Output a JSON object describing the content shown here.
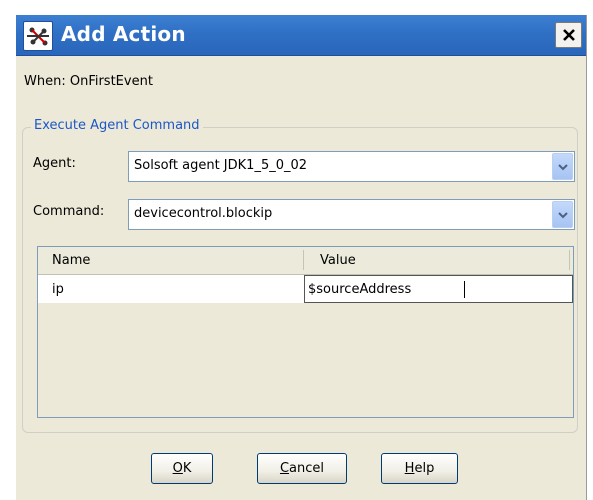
{
  "window": {
    "title": "Add Action",
    "icon": "action-icon",
    "close_label": "×"
  },
  "event_label": "When: OnFirstEvent",
  "group": {
    "label": "Execute Agent Command",
    "agent": {
      "label": "Agent:",
      "selected": "Solsoft agent JDK1_5_0_02"
    },
    "command": {
      "label": "Command:",
      "selected": "devicecontrol.blockip"
    },
    "table": {
      "columns": [
        "Name",
        "Value"
      ],
      "rows": [
        {
          "name": "ip",
          "value": "$sourceAddress"
        }
      ]
    }
  },
  "buttons": {
    "ok": {
      "mnemonic": "O",
      "rest": "K"
    },
    "cancel": {
      "mnemonic": "C",
      "rest": "ancel"
    },
    "help": {
      "mnemonic": "H",
      "rest": "elp"
    }
  },
  "colors": {
    "titlebar": "#2e6fc4",
    "group_label": "#1c57c8",
    "dialog_bg": "#ece9d8"
  }
}
